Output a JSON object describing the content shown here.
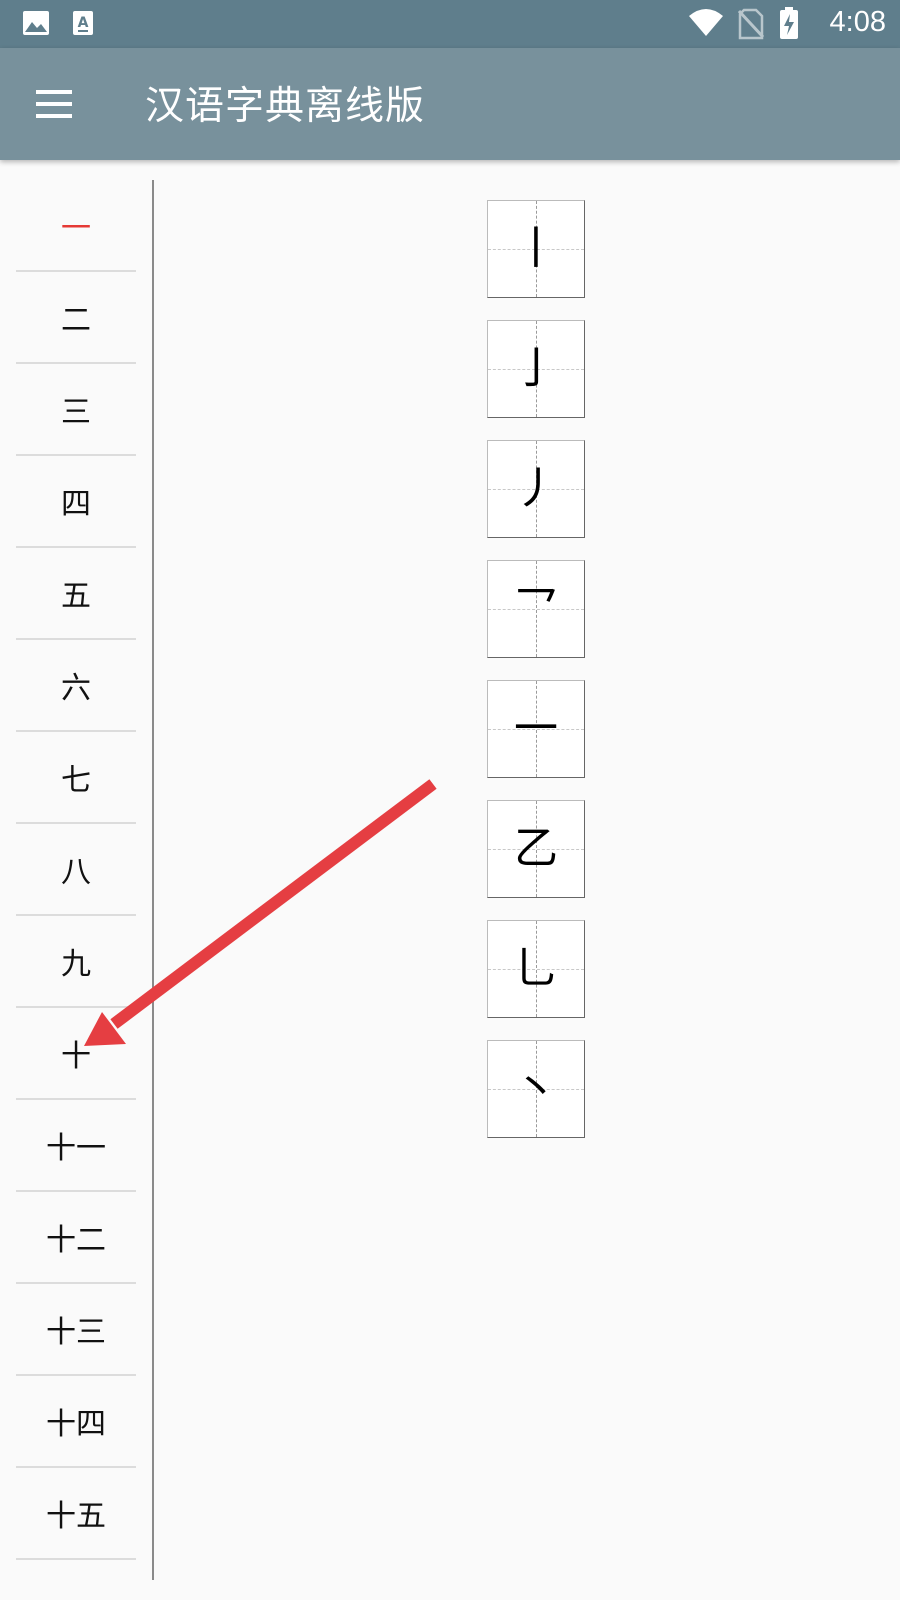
{
  "status_bar": {
    "time": "4:08",
    "left_icons": [
      "image-icon",
      "font-download-icon"
    ],
    "right_icons": [
      "wifi-icon",
      "no-sim-icon",
      "battery-charging-icon"
    ]
  },
  "toolbar": {
    "title": "汉语字典离线版",
    "menu_icon": "hamburger-menu-icon"
  },
  "sidebar": {
    "items": [
      "一",
      "二",
      "三",
      "四",
      "五",
      "六",
      "七",
      "八",
      "九",
      "十",
      "十一",
      "十二",
      "十三",
      "十四",
      "十五"
    ],
    "selected_index": 0
  },
  "strokes": [
    "丨",
    "亅",
    "丿",
    "乛",
    "一",
    "乙",
    "乚",
    "丶"
  ],
  "colors": {
    "status_bar": "#5f7e8c",
    "toolbar": "#78919c",
    "selected_item": "#e53935",
    "annotation_arrow": "#e53e42"
  }
}
